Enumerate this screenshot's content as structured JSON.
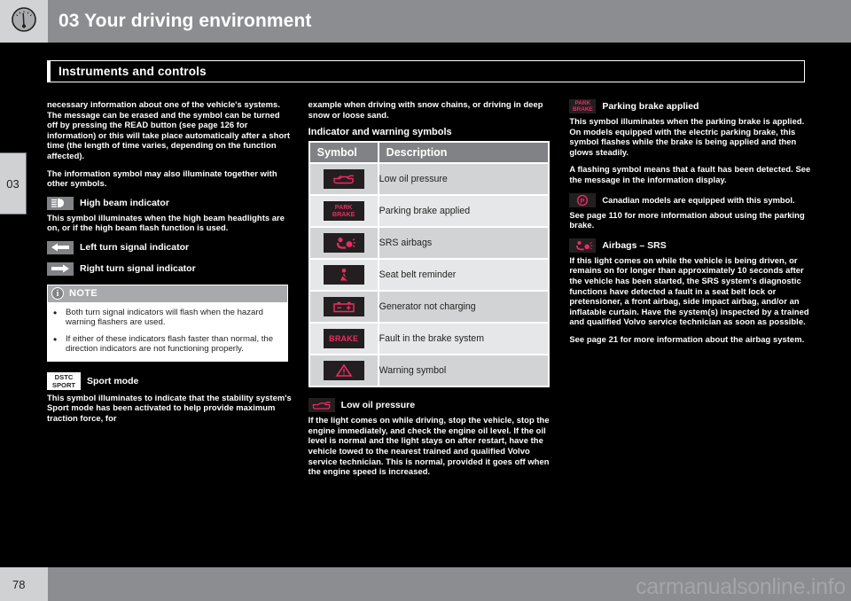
{
  "header": {
    "icon": "gauge-icon",
    "title": "03 Your driving environment"
  },
  "chapter_tab": {
    "number": "03"
  },
  "section": {
    "title": "Instruments and controls"
  },
  "footer": {
    "page_number": "78",
    "watermark": "carmanualsonline.info"
  },
  "left_column": {
    "intro_paragraph": "necessary information about one of the vehicle's systems. The message can be erased and the symbol can be turned off by pressing the READ button (see page 126 for information) or this will take place automatically after a short time (the length of time varies, depending on the function affected).",
    "paragraph_2": "The information symbol may also illuminate together with other symbols.",
    "high_beam": {
      "heading": "High beam indicator",
      "icon": "high-beam-icon",
      "text": "This symbol illuminates when the high beam headlights are on, or if the high beam flash function is used."
    },
    "left_turn": {
      "heading": "Left turn signal indicator",
      "icon": "left-arrow-icon"
    },
    "right_turn": {
      "heading": "Right turn signal indicator",
      "icon": "right-arrow-icon"
    },
    "note": {
      "icon": "info-icon",
      "title": "NOTE",
      "items": [
        "Both turn signal indicators will flash when the hazard warning flashers are used.",
        "If either of these indicators flash faster than normal, the direction indicators are not functioning properly."
      ]
    },
    "dstc": {
      "badge_line1": "DSTC",
      "badge_line2": "SPORT",
      "heading": "Sport mode",
      "text": "This symbol illuminates to indicate that the stability system's Sport mode has been activated to help provide maximum traction force, for"
    }
  },
  "middle_column": {
    "continued_text": "example when driving with snow chains, or driving in deep snow or loose sand.",
    "section_heading": "Indicator and warning symbols",
    "table": {
      "headers": [
        "Symbol",
        "Description"
      ],
      "rows": [
        {
          "icon": "low-oil-pressure-icon",
          "badge_type": "glyph",
          "badge_text": "",
          "description": "Low oil pressure"
        },
        {
          "icon": "park-brake-icon",
          "badge_type": "text2",
          "badge_text": "PARK\nBRAKE",
          "badge_line1": "PARK",
          "badge_line2": "BRAKE",
          "description": "Parking brake applied"
        },
        {
          "icon": "srs-airbag-icon",
          "badge_type": "glyph",
          "badge_text": "",
          "description": "SRS airbags"
        },
        {
          "icon": "seat-belt-icon",
          "badge_type": "glyph",
          "badge_text": "",
          "description": "Seat belt reminder"
        },
        {
          "icon": "battery-icon",
          "badge_type": "glyph",
          "badge_text": "",
          "description": "Generator not charging"
        },
        {
          "icon": "brake-text-icon",
          "badge_type": "text1",
          "badge_text": "BRAKE",
          "description": "Fault in the brake system"
        },
        {
          "icon": "warning-triangle-icon",
          "badge_type": "glyph",
          "badge_text": "",
          "description": "Warning symbol"
        }
      ]
    },
    "low_oil": {
      "icon": "low-oil-pressure-icon",
      "heading": "Low oil pressure",
      "text": "If the light comes on while driving, stop the vehicle, stop the engine immediately, and check the engine oil level. If the oil level is normal and the light stays on after restart, have the vehicle towed to the nearest trained and qualified Volvo service technician. This is normal, provided it goes off when the engine speed is increased."
    }
  },
  "right_column": {
    "parking_brake": {
      "icon": "park-brake-icon",
      "badge_line1": "PARK",
      "badge_line2": "BRAKE",
      "heading": "Parking brake applied",
      "paragraph_1": "This symbol illuminates when the parking brake is applied. On models equipped with the electric parking brake, this symbol flashes while the brake is being applied and then glows steadily.",
      "paragraph_2": "A flashing symbol means that a fault has been detected. See the message in the information display.",
      "canadian_note": "Canadian models are equipped with this symbol.",
      "canadian_icon": "p-circle-icon",
      "reference": "See page 110 for more information about using the parking brake."
    },
    "airbags": {
      "icon": "srs-airbag-icon",
      "heading": "Airbags – SRS",
      "paragraph_1": "If this light comes on while the vehicle is being driven, or remains on for longer than approximately 10 seconds after the vehicle has been started, the SRS system's diagnostic functions have detected a fault in a seat belt lock or pretensioner, a front airbag, side impact airbag, and/or an inflatable curtain. Have the system(s) inspected by a trained and qualified Volvo service technician as soon as possible.",
      "reference": "See page 21 for more information about the airbag system."
    }
  },
  "colors": {
    "warning_pink": "#ec2b63",
    "header_gray": "#8b8d91",
    "tab_gray": "#cfd1d3",
    "symbol_dark": "#231f20"
  }
}
